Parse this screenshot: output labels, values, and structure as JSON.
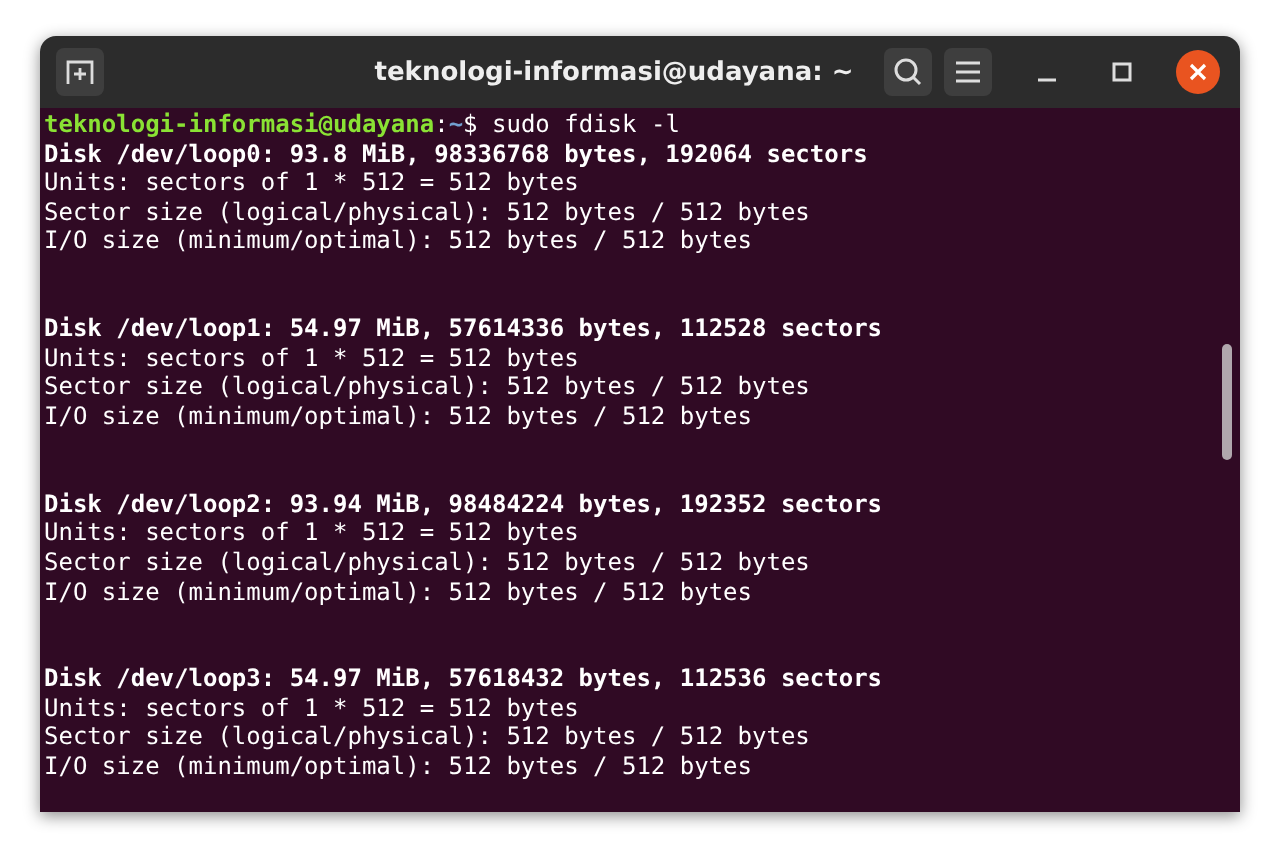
{
  "window": {
    "title": "teknologi-informasi@udayana: ~"
  },
  "prompt": {
    "user_host": "teknologi-informasi@udayana",
    "separator": ":",
    "path": "~",
    "symbol": "$",
    "command": " sudo fdisk -l"
  },
  "blocks": [
    {
      "header": "Disk /dev/loop0: 93.8 MiB, 98336768 bytes, 192064 sectors",
      "lines": [
        "Units: sectors of 1 * 512 = 512 bytes",
        "Sector size (logical/physical): 512 bytes / 512 bytes",
        "I/O size (minimum/optimal): 512 bytes / 512 bytes"
      ]
    },
    {
      "header": "Disk /dev/loop1: 54.97 MiB, 57614336 bytes, 112528 sectors",
      "lines": [
        "Units: sectors of 1 * 512 = 512 bytes",
        "Sector size (logical/physical): 512 bytes / 512 bytes",
        "I/O size (minimum/optimal): 512 bytes / 512 bytes"
      ]
    },
    {
      "header": "Disk /dev/loop2: 93.94 MiB, 98484224 bytes, 192352 sectors",
      "lines": [
        "Units: sectors of 1 * 512 = 512 bytes",
        "Sector size (logical/physical): 512 bytes / 512 bytes",
        "I/O size (minimum/optimal): 512 bytes / 512 bytes"
      ]
    },
    {
      "header": "Disk /dev/loop3: 54.97 MiB, 57618432 bytes, 112536 sectors",
      "lines": [
        "Units: sectors of 1 * 512 = 512 bytes",
        "Sector size (logical/physical): 512 bytes / 512 bytes",
        "I/O size (minimum/optimal): 512 bytes / 512 bytes"
      ]
    }
  ]
}
